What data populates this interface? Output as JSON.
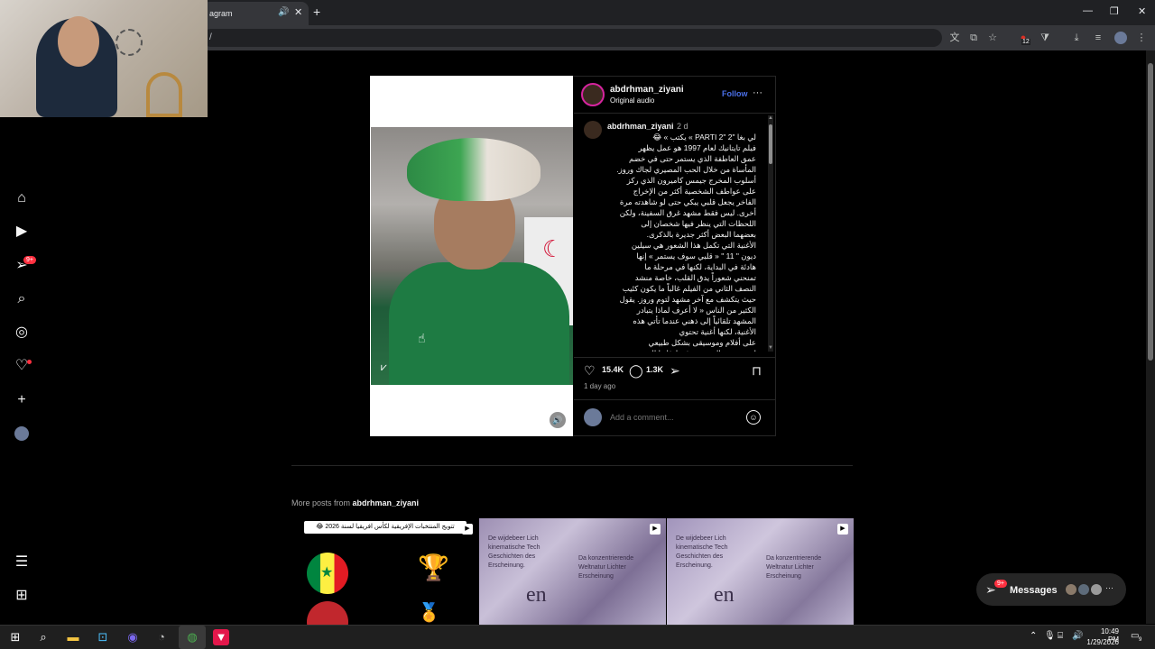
{
  "browser": {
    "tab_title": "agram",
    "tab_audio_icon": "speaker-icon",
    "new_tab_label": "+",
    "address_text": "/",
    "extension_badge": "12"
  },
  "nav": {
    "items": [
      "home-icon",
      "reels-icon",
      "messages-icon",
      "search-icon",
      "explore-icon",
      "notifications-icon",
      "create-icon",
      "profile-avatar"
    ],
    "messages_badge": "9+",
    "bottom": [
      "menu-icon",
      "also-from-meta-icon"
    ]
  },
  "post": {
    "username": "abdrhman_ziyani",
    "audio": "Original audio",
    "follow_label": "Follow",
    "more_label": "···",
    "caption_username": "abdrhman_ziyani",
    "caption_time": "2 d",
    "caption_text": "لي بغا \"PARTI 2\" 2 » يكتب » 😂\nفيلم تايتانيك لعام 1997 هو عمل يظهر\nعمق العاطفة الذي يستمر حتى في خضم\nالمأساة من خلال الحب المصيري لجاك وروز.\nأسلوب المخرج جيمس كاميرون الذي ركز\nعلى عواطف الشخصية أكثر من الإخراج\nالفاخر يجعل قلبي يبكي حتى لو شاهدته مرة\nأخرى. ليس فقط مشهد غرق السفينة، ولكن\nاللحظات التي ينظر فيها شخصان إلى\nبعضهما البعض أكثر جديرة بالذكرى.\nالأغنية التي تكمل هذا الشعور هي سيلين\nديون \" 11 \" « قلبي سوف يستمر » إنها\nهادئة في البداية، لكنها في مرحلة ما\nتمنحني شعوراً يدق القلب، خاصة منشد\nالنصف الثاني من الفيلم غالباً ما يكون كئيب\nحيث يتكشف مع آخر مشهد لتوم وروز. يقول\nالكثير من الناس « لا أعرف لماذا يتبادر\nالمشهد تلقائياً إلى ذهني عندما تأتي هذه\nالأغنية، لكنها أغنية تحتوي\nعلى أفلام وموسيقى بشكل طبيعي\nليس مجرد الشخصية فقط فإنها المرجع من",
    "likes": "15.4K",
    "comments": "1.3K",
    "age": "1 day ago",
    "comment_placeholder": "Add a comment..."
  },
  "more_posts": {
    "prefix": "More posts from ",
    "username": "abdrhman_ziyani",
    "thumb1_banner": "تتويج المنتخبات الإفريقية لكأس افريقيا لسنة 2026 😂",
    "thumb2_word": "en",
    "thumb3_word": "en",
    "thumb_text_a": "De wijdebeer Lich\nkinematische Tech\nGeschichten des\nErscheinung.",
    "thumb_text_b": "Da konzentrierende\nWeltnatur Lichter\nErscheinung",
    "reel_icon": "reel-icon"
  },
  "messages_pill": {
    "label": "Messages",
    "badge": "9+",
    "more": "···"
  },
  "taskbar": {
    "time": "10:49 PM",
    "date": "1/29/2026",
    "notif_count": "9"
  },
  "colors": {
    "accent": "#4a6fe8",
    "badge": "#ff3040",
    "background": "#000000"
  }
}
